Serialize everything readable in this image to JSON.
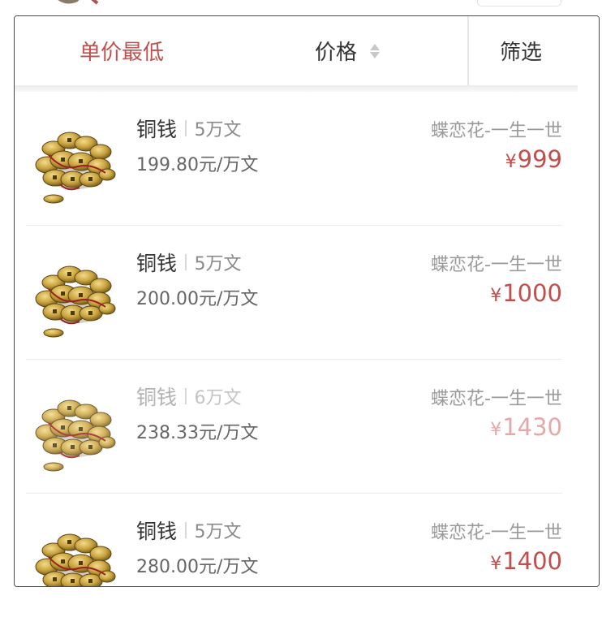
{
  "sort_bar": {
    "lowest_unit_price": "单价最低",
    "price": "价格",
    "filter": "筛选"
  },
  "colors": {
    "accent": "#c0504d",
    "accent_dim": "#e3a8aa",
    "text_primary": "#333333",
    "text_secondary": "#9a9a9a"
  },
  "listings": [
    {
      "name": "铜钱",
      "amount": "5万文",
      "unit_price": "199.80元/万文",
      "server": "蝶恋花-一生一世",
      "price_symbol": "¥",
      "price": "999",
      "icon": "copper-coins-icon",
      "dimmed": false
    },
    {
      "name": "铜钱",
      "amount": "5万文",
      "unit_price": "200.00元/万文",
      "server": "蝶恋花-一生一世",
      "price_symbol": "¥",
      "price": "1000",
      "icon": "copper-coins-icon",
      "dimmed": false
    },
    {
      "name": "铜钱",
      "amount": "6万文",
      "unit_price": "238.33元/万文",
      "server": "蝶恋花-一生一世",
      "price_symbol": "¥",
      "price": "1430",
      "icon": "copper-coins-icon",
      "dimmed": true
    },
    {
      "name": "铜钱",
      "amount": "5万文",
      "unit_price": "280.00元/万文",
      "server": "蝶恋花-一生一世",
      "price_symbol": "¥",
      "price": "1400",
      "icon": "copper-coins-icon",
      "dimmed": false
    }
  ]
}
